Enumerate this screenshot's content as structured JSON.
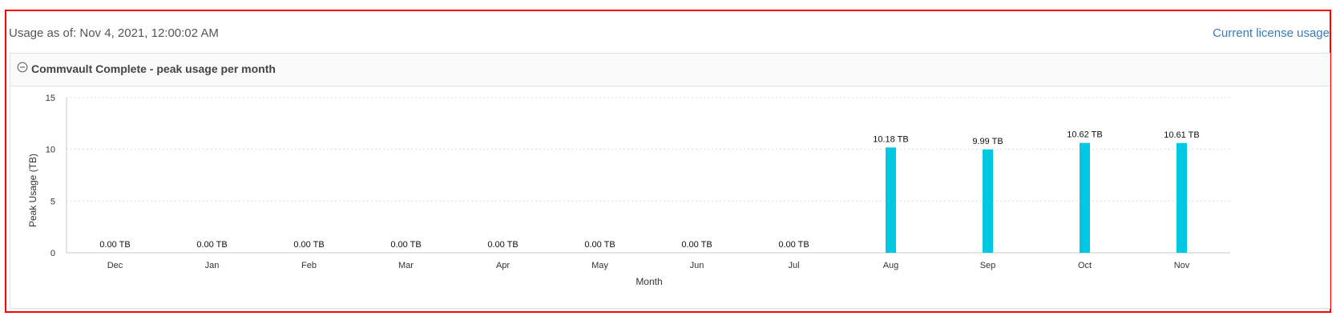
{
  "header": {
    "usage_as_of": "Usage as of: Nov 4, 2021, 12:00:02 AM",
    "license_link": "Current license usage"
  },
  "panel": {
    "title": "Commvault Complete - peak usage per month",
    "collapse_icon": "collapse-circle-minus-icon"
  },
  "chart_data": {
    "type": "bar",
    "title": "",
    "xlabel": "Month",
    "ylabel": "Peak Usage (TB)",
    "categories": [
      "Dec",
      "Jan",
      "Feb",
      "Mar",
      "Apr",
      "May",
      "Jun",
      "Jul",
      "Aug",
      "Sep",
      "Oct",
      "Nov"
    ],
    "values": [
      0,
      0,
      0,
      0,
      0,
      0,
      0,
      0,
      10.18,
      9.99,
      10.62,
      10.61
    ],
    "data_labels": [
      "0.00 TB",
      "0.00 TB",
      "0.00 TB",
      "0.00 TB",
      "0.00 TB",
      "0.00 TB",
      "0.00 TB",
      "0.00 TB",
      "10.18 TB",
      "9.99 TB",
      "10.62 TB",
      "10.61 TB"
    ],
    "ylim": [
      0,
      15
    ],
    "yticks": [
      "0",
      "5",
      "10",
      "15"
    ],
    "grid": true,
    "bar_color": "#00c8e3"
  }
}
